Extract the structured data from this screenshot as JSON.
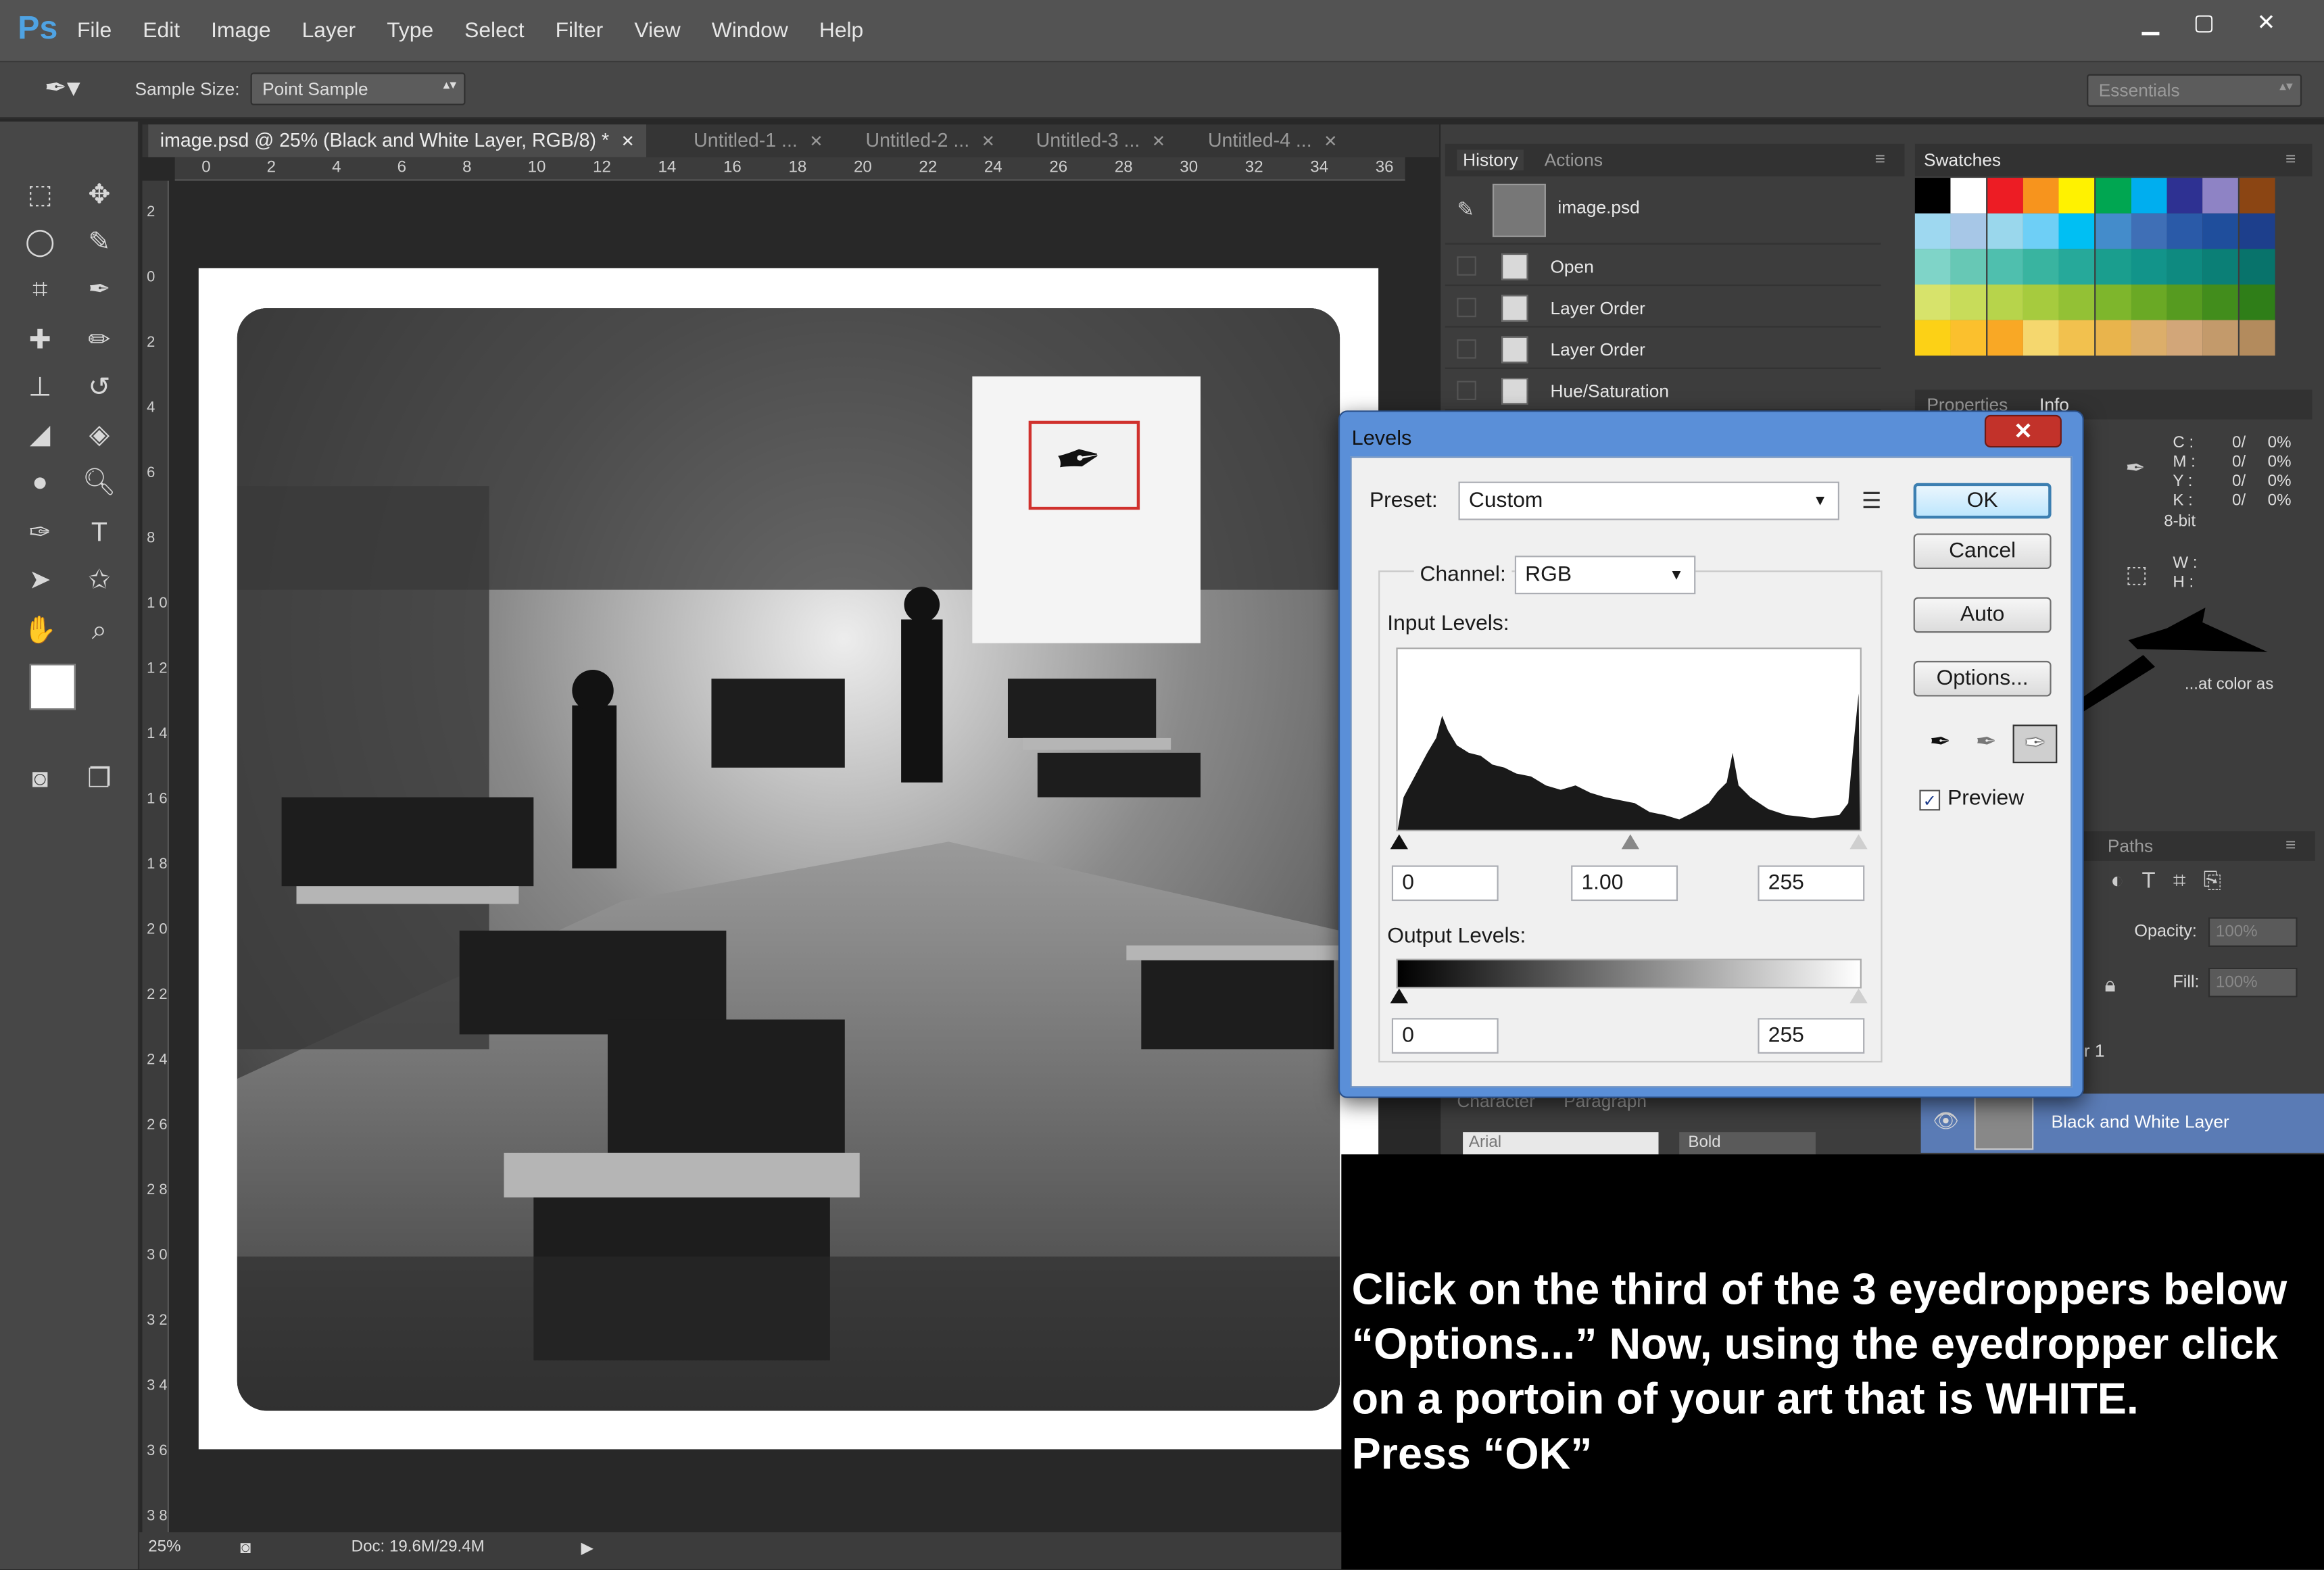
{
  "app": {
    "logo": "Ps",
    "menu": [
      "File",
      "Edit",
      "Image",
      "Layer",
      "Type",
      "Select",
      "Filter",
      "View",
      "Window",
      "Help"
    ]
  },
  "options_bar": {
    "sample_size_label": "Sample Size:",
    "sample_size_value": "Point Sample",
    "workspace": "Essentials"
  },
  "tabs": [
    {
      "label": "image.psd @ 25% (Black and White Layer, RGB/8) *",
      "active": true
    },
    {
      "label": "Untitled-1 ..."
    },
    {
      "label": "Untitled-2 ..."
    },
    {
      "label": "Untitled-3 ..."
    },
    {
      "label": "Untitled-4 ..."
    }
  ],
  "ruler": {
    "h": [
      "0",
      "2",
      "4",
      "6",
      "8",
      "10",
      "12",
      "14",
      "16",
      "18",
      "20",
      "22",
      "24",
      "26",
      "28",
      "30",
      "32",
      "34",
      "36"
    ],
    "v": [
      "2",
      "0",
      "2",
      "4",
      "6",
      "8",
      "1 0",
      "1 2",
      "1 4",
      "1 6",
      "1 8",
      "2 0",
      "2 2",
      "2 4",
      "2 6",
      "2 8",
      "3 0",
      "3 2",
      "3 4",
      "3 6",
      "3 8"
    ]
  },
  "status": {
    "zoom": "25%",
    "doc": "Doc: 19.6M/29.4M"
  },
  "history": {
    "tabs": [
      "History",
      "Actions"
    ],
    "snapshot": "image.psd",
    "items": [
      "Open",
      "Layer Order",
      "Layer Order",
      "Hue/Saturation"
    ]
  },
  "swatches": {
    "tab": "Swatches",
    "colors": [
      [
        "#000000",
        "#ffffff",
        "#ed1c24",
        "#f7941d",
        "#fff200",
        "#00a651",
        "#00aeef",
        "#2e3192",
        "#8e83c5",
        "#8b4513"
      ],
      [
        "#9ed8f0",
        "#a7c7e7",
        "#9ad7ec",
        "#6ecff6",
        "#00bff3",
        "#448ccb",
        "#3f6fb6",
        "#2a5aa8",
        "#1f4e9c",
        "#1d3f8c"
      ],
      [
        "#7fd4c8",
        "#67c8b5",
        "#4fbfae",
        "#39b4a0",
        "#26a99a",
        "#1a9e8e",
        "#12948a",
        "#0e8a80",
        "#0b7f76",
        "#08736b"
      ],
      [
        "#d7e36b",
        "#c8dc5a",
        "#b7d44b",
        "#a6cb3e",
        "#93c135",
        "#7eb62c",
        "#6aa925",
        "#569b20",
        "#428d1c",
        "#2f7e18"
      ],
      [
        "#fcd116",
        "#fbc02d",
        "#f9a825",
        "#f5d76e",
        "#f2c14e",
        "#e9b44c",
        "#dcae6a",
        "#d2a679",
        "#c39a6b",
        "#b38b5d"
      ]
    ]
  },
  "info": {
    "tabs": [
      "Properties",
      "Info"
    ],
    "cmyk": [
      [
        "C :",
        "0/",
        "0%"
      ],
      [
        "M :",
        "0/",
        "0%"
      ],
      [
        "Y :",
        "0/",
        "0%"
      ],
      [
        "K :",
        "0/",
        "0%"
      ]
    ],
    "bit": "8-bit",
    "wh": [
      "W :",
      "H :"
    ],
    "partial": "...at color as"
  },
  "layers": {
    "tab": "Paths",
    "opacity_label": "Opacity:",
    "opacity": "100%",
    "fill_label": "Fill:",
    "fill": "100%",
    "partial_layer": "r 1",
    "layer_name": "Black and White Layer"
  },
  "character": {
    "tabs": [
      "Character",
      "Paragraph"
    ],
    "font": "Arial",
    "style": "Bold"
  },
  "levels": {
    "title": "Levels",
    "preset_label": "Preset:",
    "preset": "Custom",
    "channel_label": "Channel:",
    "channel": "RGB",
    "input_label": "Input Levels:",
    "input_values": [
      "0",
      "1.00",
      "255"
    ],
    "output_label": "Output Levels:",
    "output_values": [
      "0",
      "255"
    ],
    "buttons": {
      "ok": "OK",
      "cancel": "Cancel",
      "auto": "Auto",
      "options": "Options..."
    },
    "preview_label": "Preview",
    "preview_checked": true
  },
  "instruction": "Click on the third of the 3 eyedroppers below\n“Options...”  Now, using the eyedropper click\non a portoin of your art that is WHITE.\nPress “OK”",
  "colors": {
    "accent": "#4fa3e3",
    "highlight_box": "#d0312d",
    "dialog_frame": "#5a8fd8"
  }
}
